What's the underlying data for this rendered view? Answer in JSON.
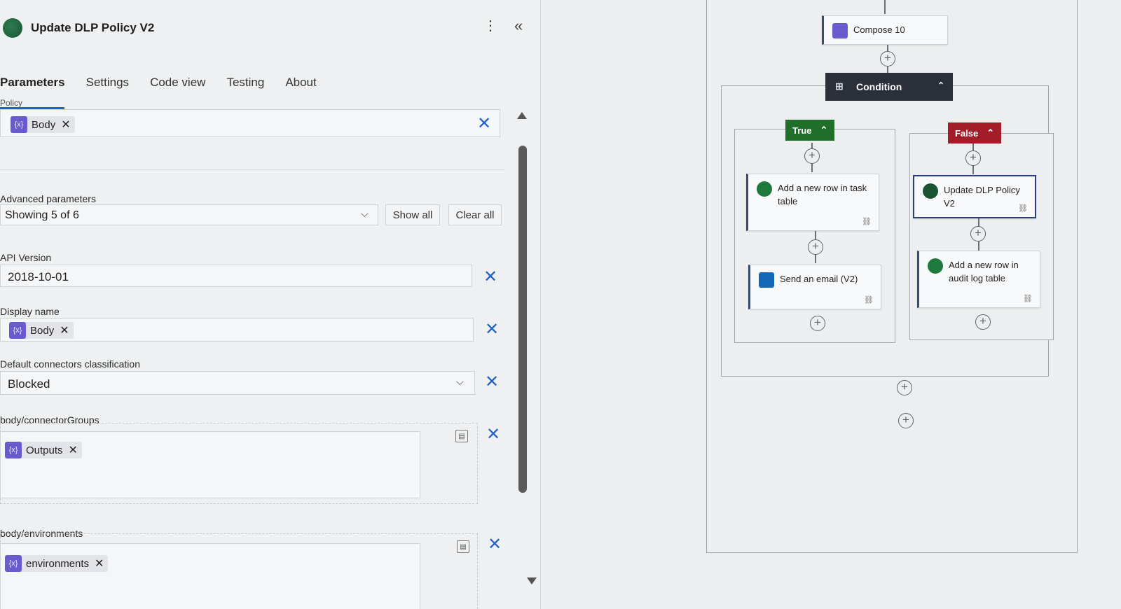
{
  "panel": {
    "title": "Update DLP Policy V2",
    "tabs": [
      {
        "label": "Parameters",
        "active": true
      },
      {
        "label": "Settings"
      },
      {
        "label": "Code view"
      },
      {
        "label": "Testing"
      },
      {
        "label": "About"
      }
    ],
    "fields": {
      "policy": {
        "label": "Policy",
        "token": "Body"
      },
      "advanced": {
        "label": "Advanced parameters",
        "value": "Showing 5 of 6",
        "show_all": "Show all",
        "clear_all": "Clear all"
      },
      "api_version": {
        "label": "API Version",
        "value": "2018-10-01"
      },
      "display_name": {
        "label": "Display name",
        "token": "Body"
      },
      "default_class": {
        "label": "Default connectors classification",
        "value": "Blocked"
      },
      "connector_groups": {
        "label": "body/connectorGroups",
        "token": "Outputs"
      },
      "environments": {
        "label": "body/environments",
        "token": "environments"
      }
    }
  },
  "canvas": {
    "compose": {
      "title": "Compose 10"
    },
    "condition": {
      "title": "Condition"
    },
    "true_branch": {
      "label": "True",
      "actions": [
        {
          "title": "Add a new row in task table",
          "icon": "dataverse-icon"
        },
        {
          "title": "Send an email (V2)",
          "icon": "outlook-icon"
        }
      ]
    },
    "false_branch": {
      "label": "False",
      "actions": [
        {
          "title": "Update DLP Policy V2",
          "icon": "power-platform-icon"
        },
        {
          "title": "Add a new row in audit log table",
          "icon": "dataverse-icon"
        }
      ]
    }
  },
  "colors": {
    "accent_blue": "#2262c6",
    "true_green": "#1f6f2a",
    "false_red": "#a11d2a",
    "condition_dark": "#2a2f38",
    "token_purple": "#6a5acd"
  }
}
